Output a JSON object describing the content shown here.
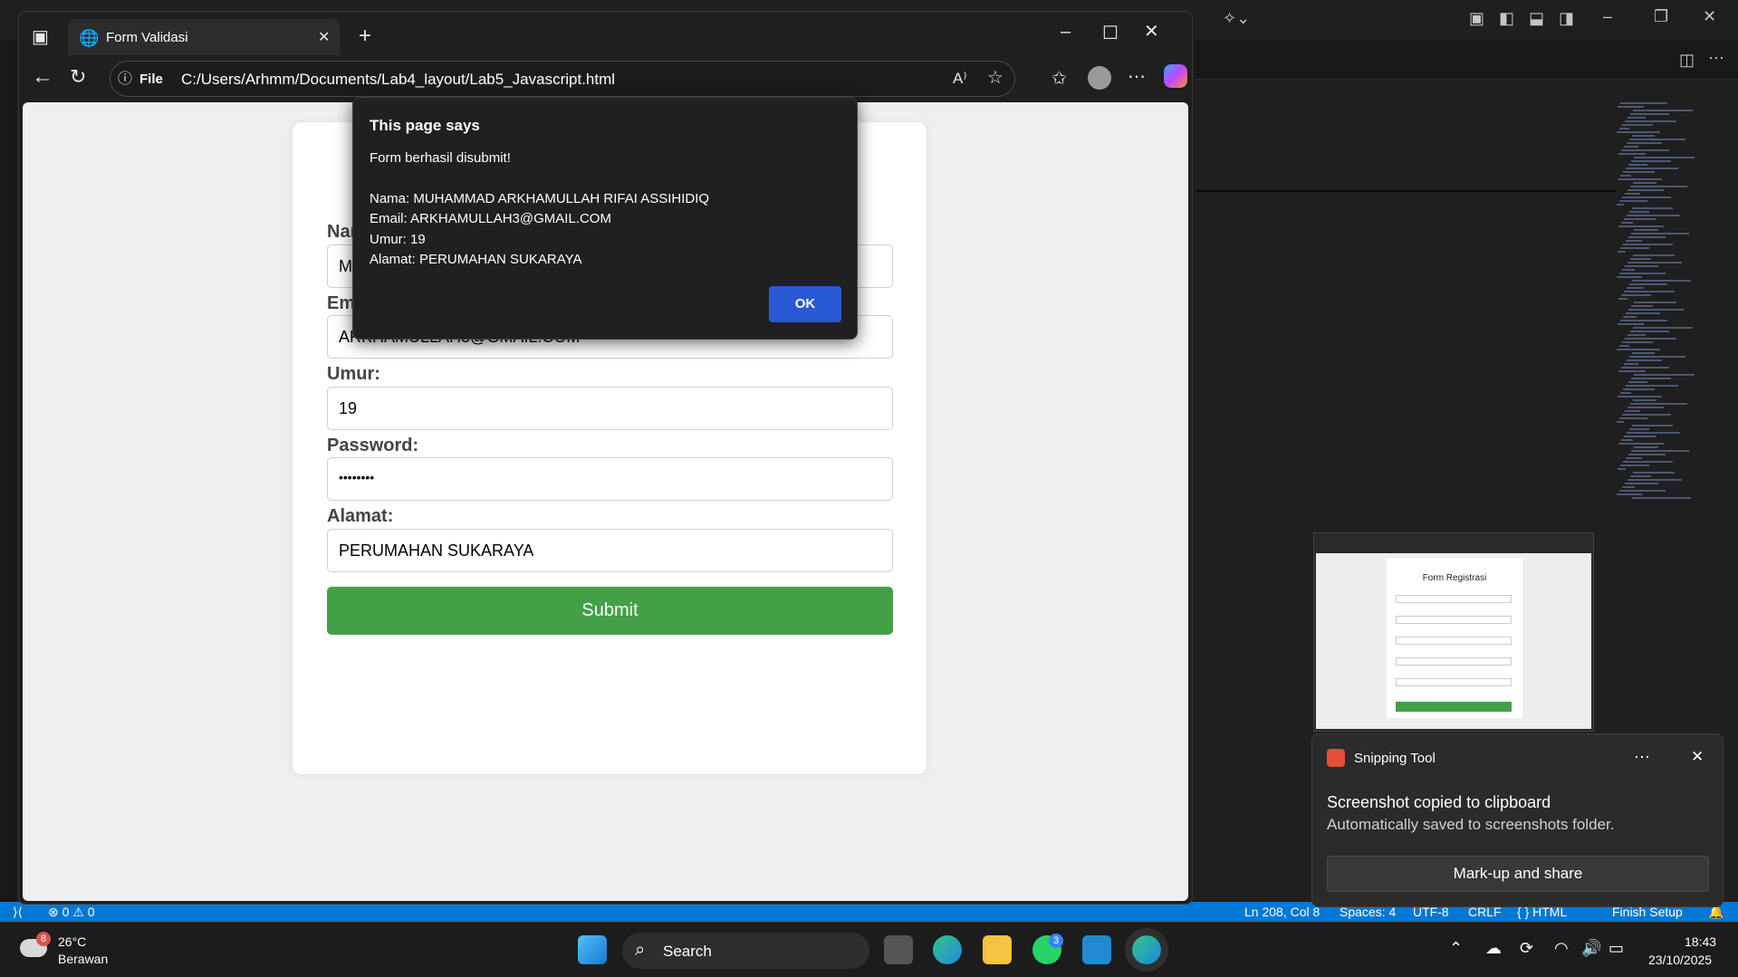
{
  "browser": {
    "tab_title": "Form Validasi",
    "address_scheme": "File",
    "address_url": "C:/Users/Arhmm/Documents/Lab4_layout/Lab5_Javascript.html"
  },
  "form": {
    "labels": {
      "nama_partial": "Nar",
      "email": "Email:",
      "umur": "Umur:",
      "password": "Password:",
      "alamat": "Alamat:"
    },
    "values": {
      "nama_partial": "MU",
      "email": "ARKHAMULLAH3@GMAIL.COM",
      "umur": "19",
      "password_masked": "••••••••",
      "alamat": "PERUMAHAN SUKARAYA"
    },
    "submit_label": "Submit"
  },
  "dialog": {
    "title": "This page says",
    "message": "Form berhasil disubmit!",
    "lines": [
      "Nama: MUHAMMAD ARKHAMULLAH RIFAI ASSIHIDIQ",
      "Email: ARKHAMULLAH3@GMAIL.COM",
      "Umur: 19",
      "Alamat: PERUMAHAN SUKARAYA"
    ],
    "ok_label": "OK"
  },
  "snip_preview": {
    "form_title": "Form Registrasi"
  },
  "toast": {
    "app_name": "Snipping Tool",
    "heading": "Screenshot copied to clipboard",
    "subtext": "Automatically saved to screenshots folder.",
    "button_label": "Mark-up and share"
  },
  "statusbar": {
    "problems": "⊗ 0 ⚠ 0",
    "position": "Ln 208, Col 8",
    "spaces": "Spaces: 4",
    "encoding": "UTF-8",
    "eol": "CRLF",
    "language": "{ } HTML",
    "setup": "Finish Setup"
  },
  "taskbar": {
    "weather_temp": "26°C",
    "weather_desc": "Berawan",
    "weather_badge": "8",
    "search_label": "Search",
    "whatsapp_badge": "3",
    "time": "18:43",
    "date": "23/10/2025"
  },
  "colors": {
    "accent_blue": "#0078d4",
    "submit_green": "#43a047",
    "ok_blue": "#2958d4"
  }
}
